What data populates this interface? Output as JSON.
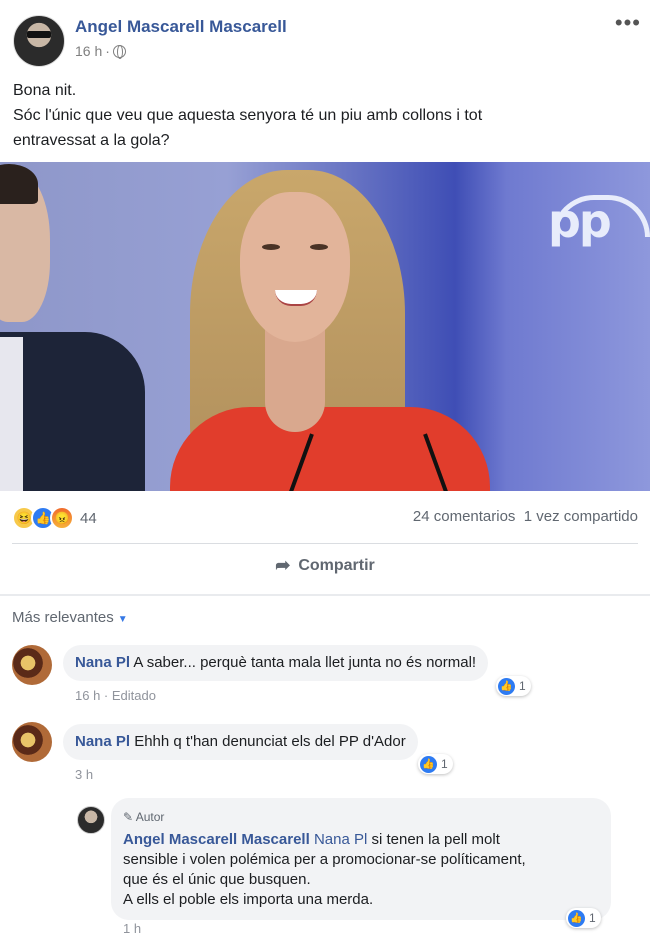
{
  "post": {
    "author": "Angel Mascarell Mascarell",
    "time": "16 h",
    "separator": "·",
    "privacy_icon": "globe-icon",
    "more_label": "•••",
    "text_lines": [
      "Bona nit.",
      "Sóc l'únic que veu que aquesta senyora té un piu amb collons i tot",
      "entravessat a la gola?"
    ],
    "photo_logo_text": "pp"
  },
  "engagement": {
    "reaction_icons": [
      "haha-reaction-icon",
      "like-reaction-icon",
      "angry-reaction-icon"
    ],
    "reaction_count": "44",
    "stats_text": "24 comentarios  1 vez compartido",
    "share_label": "Compartir"
  },
  "comments_header": {
    "sort_label": "Más relevantes",
    "caret": "▼"
  },
  "comments": [
    {
      "author": "Nana Pl",
      "text": "A saber... perquè tanta mala llet junta no és normal!",
      "meta": "16 h · Editado",
      "likes": "1"
    },
    {
      "author": "Nana Pl",
      "text": "Ehhh q t'han denunciat els del PP d'Ador",
      "meta": "3 h",
      "likes": "1"
    }
  ],
  "reply": {
    "badge": "Autor",
    "author": "Angel Mascarell Mascarell",
    "mention": "Nana Pl",
    "text_line1": " si tenen la pell molt",
    "text_line2": "sensible i volen polémica per a promocionar-se políticament,",
    "text_line3": "que és el únic que busquen.",
    "text_line4": "A ells el poble els importa una merda.",
    "meta": "1 h",
    "likes": "1"
  },
  "colors": {
    "link": "#385898",
    "like_blue": "#2e7bf2",
    "muted": "#606770"
  }
}
